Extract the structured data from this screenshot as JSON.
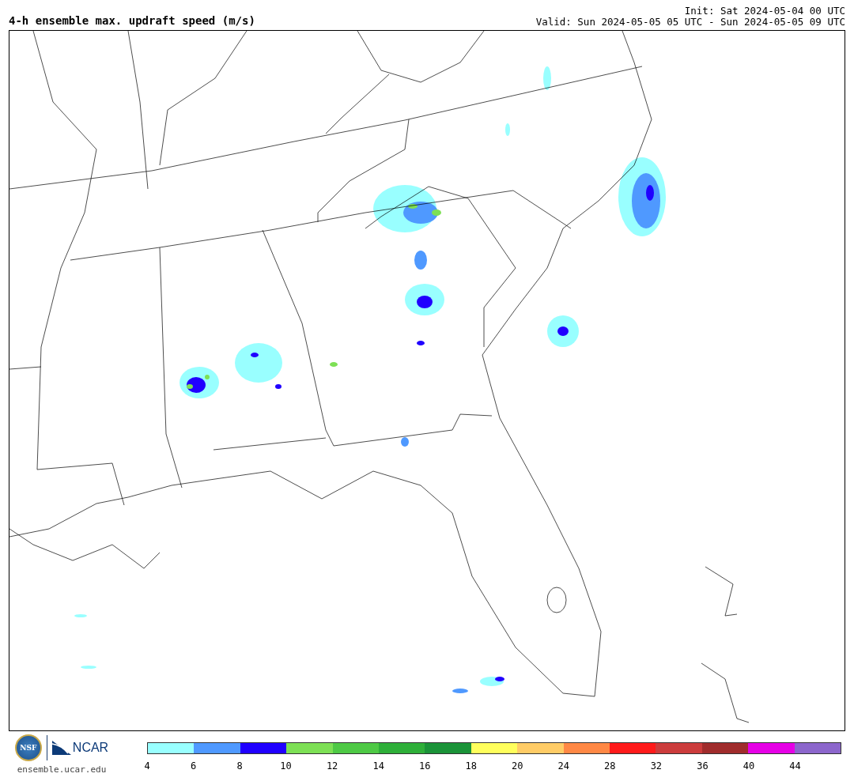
{
  "title": "4-h ensemble max. updraft speed (m/s)",
  "init": "Init: Sat 2024-05-04 00 UTC",
  "valid": "Valid: Sun 2024-05-05 05 UTC - Sun 2024-05-05 09 UTC",
  "logos": {
    "seal": "NSF",
    "org": "NCAR",
    "url": "ensemble.ucar.edu"
  },
  "colorbar": {
    "segments": [
      {
        "color": "#99ffff"
      },
      {
        "color": "#4f99ff"
      },
      {
        "color": "#2000ff"
      },
      {
        "color": "#7de055"
      },
      {
        "color": "#4ec945"
      },
      {
        "color": "#2eaf39"
      },
      {
        "color": "#1a9338"
      },
      {
        "color": "#ffff5c"
      },
      {
        "color": "#ffcc66"
      },
      {
        "color": "#ff8845"
      },
      {
        "color": "#ff1a1a"
      },
      {
        "color": "#cc3c3c"
      },
      {
        "color": "#a02c2c"
      },
      {
        "color": "#e600e6"
      },
      {
        "color": "#8c66cc"
      }
    ],
    "ticks": [
      "4",
      "6",
      "8",
      "10",
      "12",
      "14",
      "16",
      "18",
      "20",
      "24",
      "28",
      "32",
      "36",
      "40",
      "44"
    ]
  }
}
